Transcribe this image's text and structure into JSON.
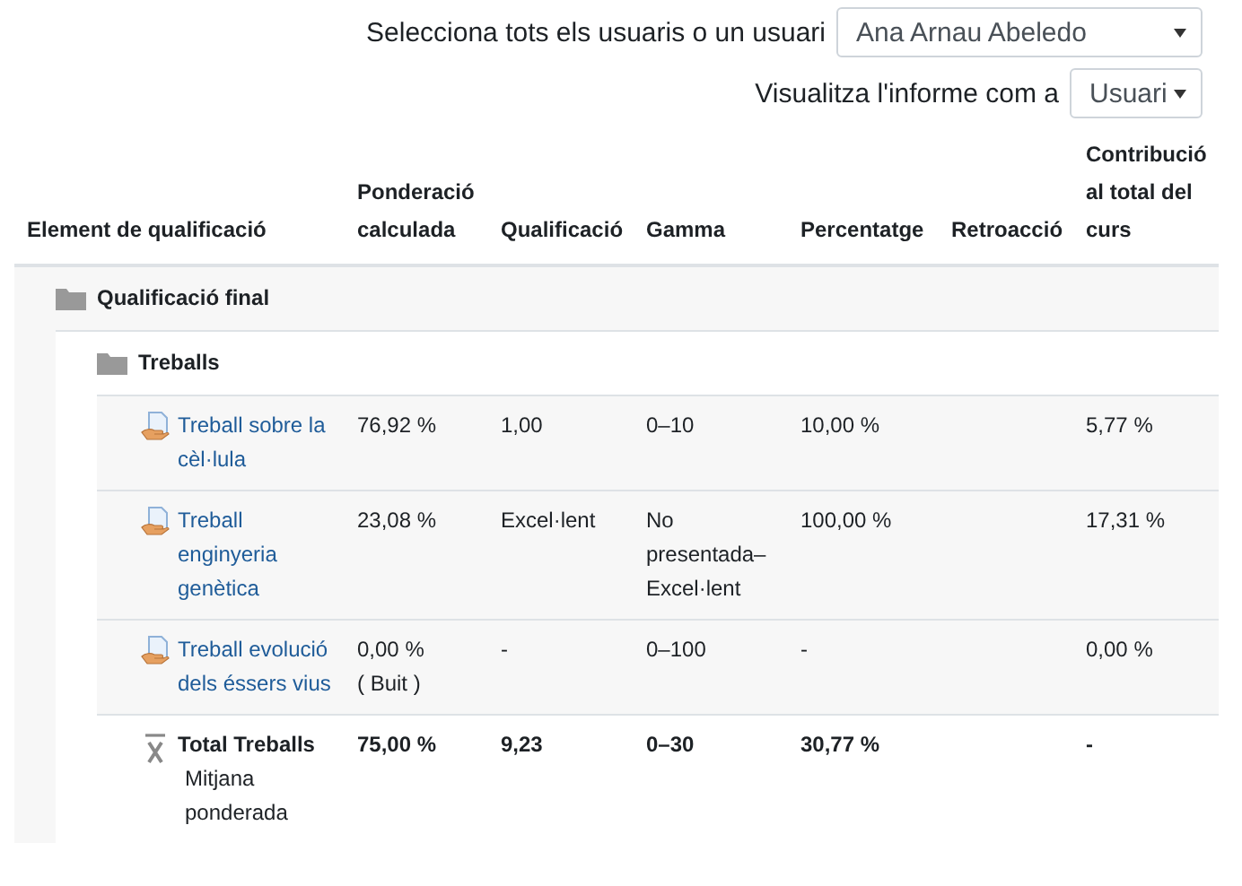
{
  "user_select": {
    "label": "Selecciona tots els usuaris o un usuari",
    "value": "Ana Arnau Abeledo"
  },
  "view_select": {
    "label": "Visualitza l'informe com a",
    "value": "Usuari"
  },
  "table": {
    "columns": [
      "Element de qualificació",
      "Ponderació calculada",
      "Qualificació",
      "Gamma",
      "Percentatge",
      "Retroacció",
      "Contribució al total del curs"
    ],
    "rows": [
      {
        "kind": "category",
        "name": "Qualificació final",
        "children": [
          {
            "kind": "category",
            "name": "Treballs",
            "children": [
              {
                "kind": "item",
                "name": "Treball sobre la cèl·lula",
                "weight": "76,92 %",
                "grade": "1,00",
                "range": "0–10",
                "percentage": "10,00 %",
                "contribution": "5,77 %"
              },
              {
                "kind": "item",
                "name": "Treball enginyeria genètica",
                "weight": "23,08 %",
                "grade": "Excel·lent",
                "range": "No presentada–Excel·lent",
                "percentage": "100,00 %",
                "contribution": "17,31 %"
              },
              {
                "kind": "item",
                "name": "Treball evolució dels éssers vius",
                "weight": "0,00 %",
                "weight_note": "( Buit )",
                "grade": "-",
                "range": "0–100",
                "percentage": "-",
                "contribution": "0,00 %"
              },
              {
                "kind": "total",
                "name": "Total Treballs",
                "subtitle": "Mitjana ponderada",
                "weight": "75,00 %",
                "grade": "9,23",
                "range": "0–30",
                "percentage": "30,77 %",
                "contribution": "-"
              }
            ]
          }
        ]
      }
    ]
  }
}
